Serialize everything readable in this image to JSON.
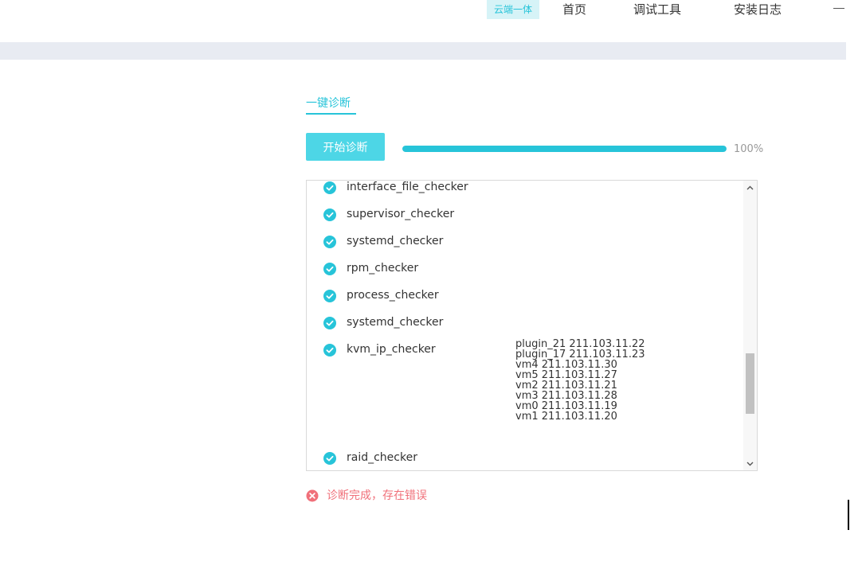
{
  "nav": {
    "badge": "云端一体",
    "home": "首页",
    "tools": "调试工具",
    "log": "安装日志"
  },
  "section": {
    "tab_label": "一键诊断"
  },
  "diagnose": {
    "start_label": "开始诊断",
    "progress_text": "100%",
    "progress_fraction": 1.0
  },
  "results": [
    {
      "name": "interface_file_checker",
      "details": []
    },
    {
      "name": "supervisor_checker",
      "details": []
    },
    {
      "name": "systemd_checker",
      "details": []
    },
    {
      "name": "rpm_checker",
      "details": []
    },
    {
      "name": "process_checker",
      "details": []
    },
    {
      "name": "systemd_checker",
      "details": []
    },
    {
      "name": "kvm_ip_checker",
      "details": [
        "plugin_21 211.103.11.22",
        "plugin_17 211.103.11.23",
        "vm4 211.103.11.30",
        "vm5 211.103.11.27",
        "vm2 211.103.11.21",
        "vm3 211.103.11.28",
        "vm0 211.103.11.19",
        "vm1 211.103.11.20"
      ]
    },
    {
      "name": "raid_checker",
      "details": []
    }
  ],
  "status": {
    "message": "诊断完成，存在错误"
  },
  "icons": {
    "check": "check-circle-icon",
    "error": "close-circle-icon",
    "minimize": "minimize-icon",
    "scroll_up": "chevron-up-icon",
    "scroll_down": "chevron-down-icon"
  },
  "colors": {
    "accent": "#27c4d9",
    "button": "#4dd6e6",
    "error": "#f0707a"
  }
}
